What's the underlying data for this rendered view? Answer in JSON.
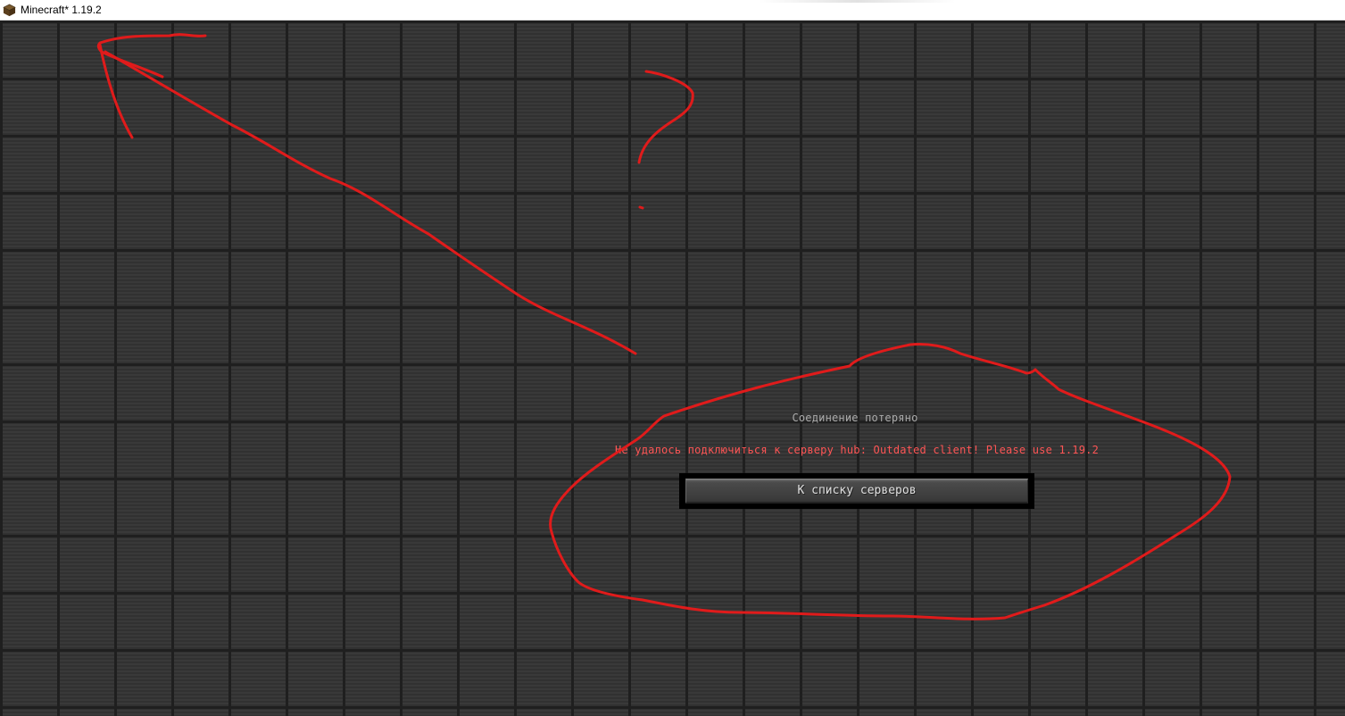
{
  "window": {
    "title": "Minecraft* 1.19.2",
    "icon": "minecraft-grass-block-icon"
  },
  "disconnect_screen": {
    "title": "Соединение потеряно",
    "reason": "Не удалось подключиться к серверу hub: Outdated client! Please use 1.19.2",
    "back_button_label": "К списку серверов"
  },
  "colors": {
    "title_text": "#aaaaaa",
    "reason_text": "#ff5555",
    "annotation_red": "#e01b1b"
  }
}
